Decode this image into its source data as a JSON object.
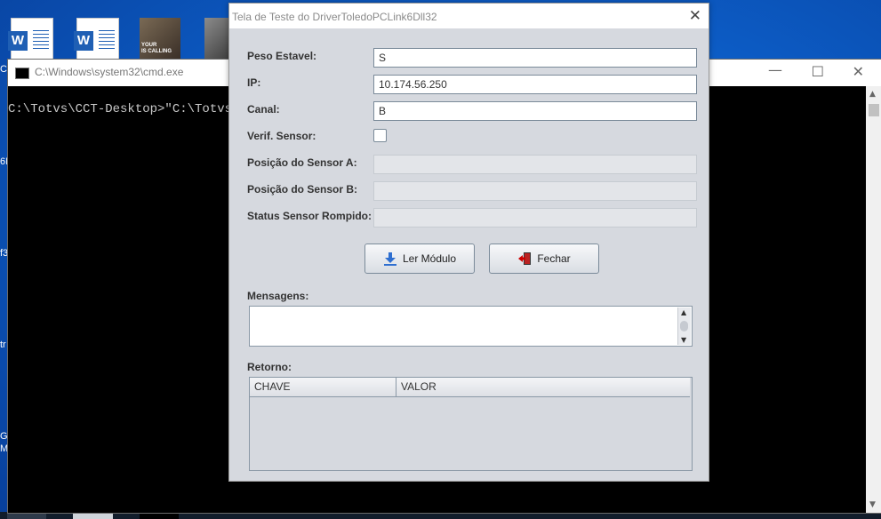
{
  "desktop": {
    "thumb_caption": "YOUR\nIS CALLING",
    "edge_texts": [
      "C",
      "6I",
      "f3",
      "tr",
      "Gc",
      "M"
    ],
    "word_icon_letter": "W"
  },
  "cmd": {
    "title": "C:\\Windows\\system32\\cmd.exe",
    "minimize": "—",
    "maximize": "☐",
    "close": "✕",
    "line": "C:\\Totvs\\CCT-Desktop>\"C:\\Totvs\\"
  },
  "dialog": {
    "title": "Tela de Teste do DriverToledoPCLink6Dll32",
    "close": "✕",
    "fields": {
      "peso_estavel": {
        "label": "Peso Estavel:",
        "value": "S"
      },
      "ip": {
        "label": "IP:",
        "value": "10.174.56.250"
      },
      "canal": {
        "label": "Canal:",
        "value": "B"
      },
      "verif_sensor": {
        "label": "Verif. Sensor:",
        "checked": false
      },
      "posicao_sensor_a": {
        "label": "Posição do Sensor A:",
        "value": ""
      },
      "posicao_sensor_b": {
        "label": "Posição do Sensor B:",
        "value": ""
      },
      "status_sensor": {
        "label": "Status Sensor Rompido:",
        "value": ""
      }
    },
    "buttons": {
      "ler_modulo": "Ler Módulo",
      "fechar": "Fechar"
    },
    "mensagens_label": "Mensagens:",
    "retorno_label": "Retorno:",
    "table": {
      "columns": [
        "CHAVE",
        "VALOR"
      ],
      "rows": []
    }
  }
}
